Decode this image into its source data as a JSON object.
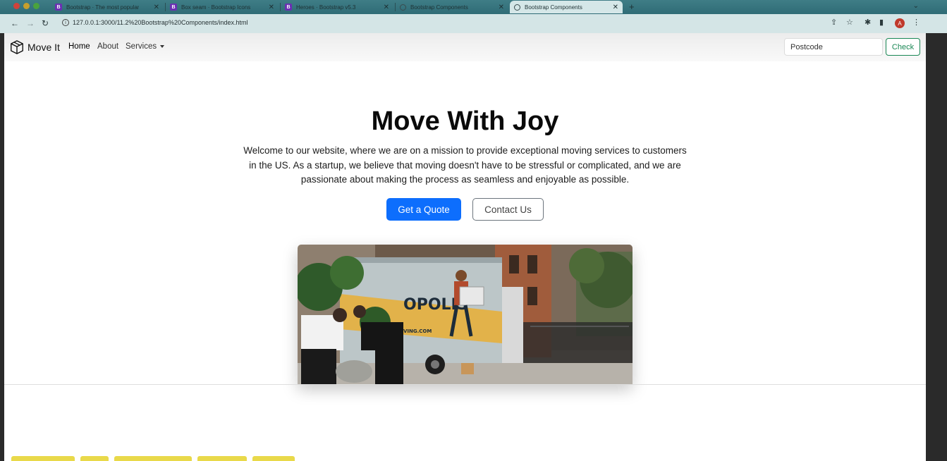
{
  "browser": {
    "tabs": [
      {
        "title": "Bootstrap · The most popular",
        "favicon": "bootstrap-icon",
        "active": false
      },
      {
        "title": "Box seam · Bootstrap Icons",
        "favicon": "bootstrap-icon",
        "active": false
      },
      {
        "title": "Heroes · Bootstrap v5.3",
        "favicon": "bootstrap-icon",
        "active": false
      },
      {
        "title": "Bootstrap Components",
        "favicon": "globe-icon",
        "active": false
      },
      {
        "title": "Bootstrap Components",
        "favicon": "globe-icon",
        "active": true
      }
    ],
    "favicon_letter": "B",
    "url": "127.0.0.1:3000/11.2%20Bootstrap%20Components/index.html",
    "profile_initial": "A"
  },
  "navbar": {
    "brand": "Move It",
    "links": [
      "Home",
      "About",
      "Services"
    ],
    "postcode_placeholder": "Postcode",
    "check_label": "Check"
  },
  "hero": {
    "title": "Move With Joy",
    "lead": "Welcome to our website, where we are on a mission to provide exceptional moving services to customers in the US. As a startup, we believe that moving doesn't have to be stressful or complicated, and we are passionate about making the process as seamless and enjoyable as possible.",
    "primary_button": "Get a Quote",
    "secondary_button": "Contact Us",
    "image_text": {
      "brand": "OPOLIS",
      "site": "VING.COM"
    }
  },
  "colors": {
    "primary": "#0d6efd",
    "success": "#198754",
    "tabbar": "#3a7780",
    "addressbar": "#d4e5e6"
  }
}
